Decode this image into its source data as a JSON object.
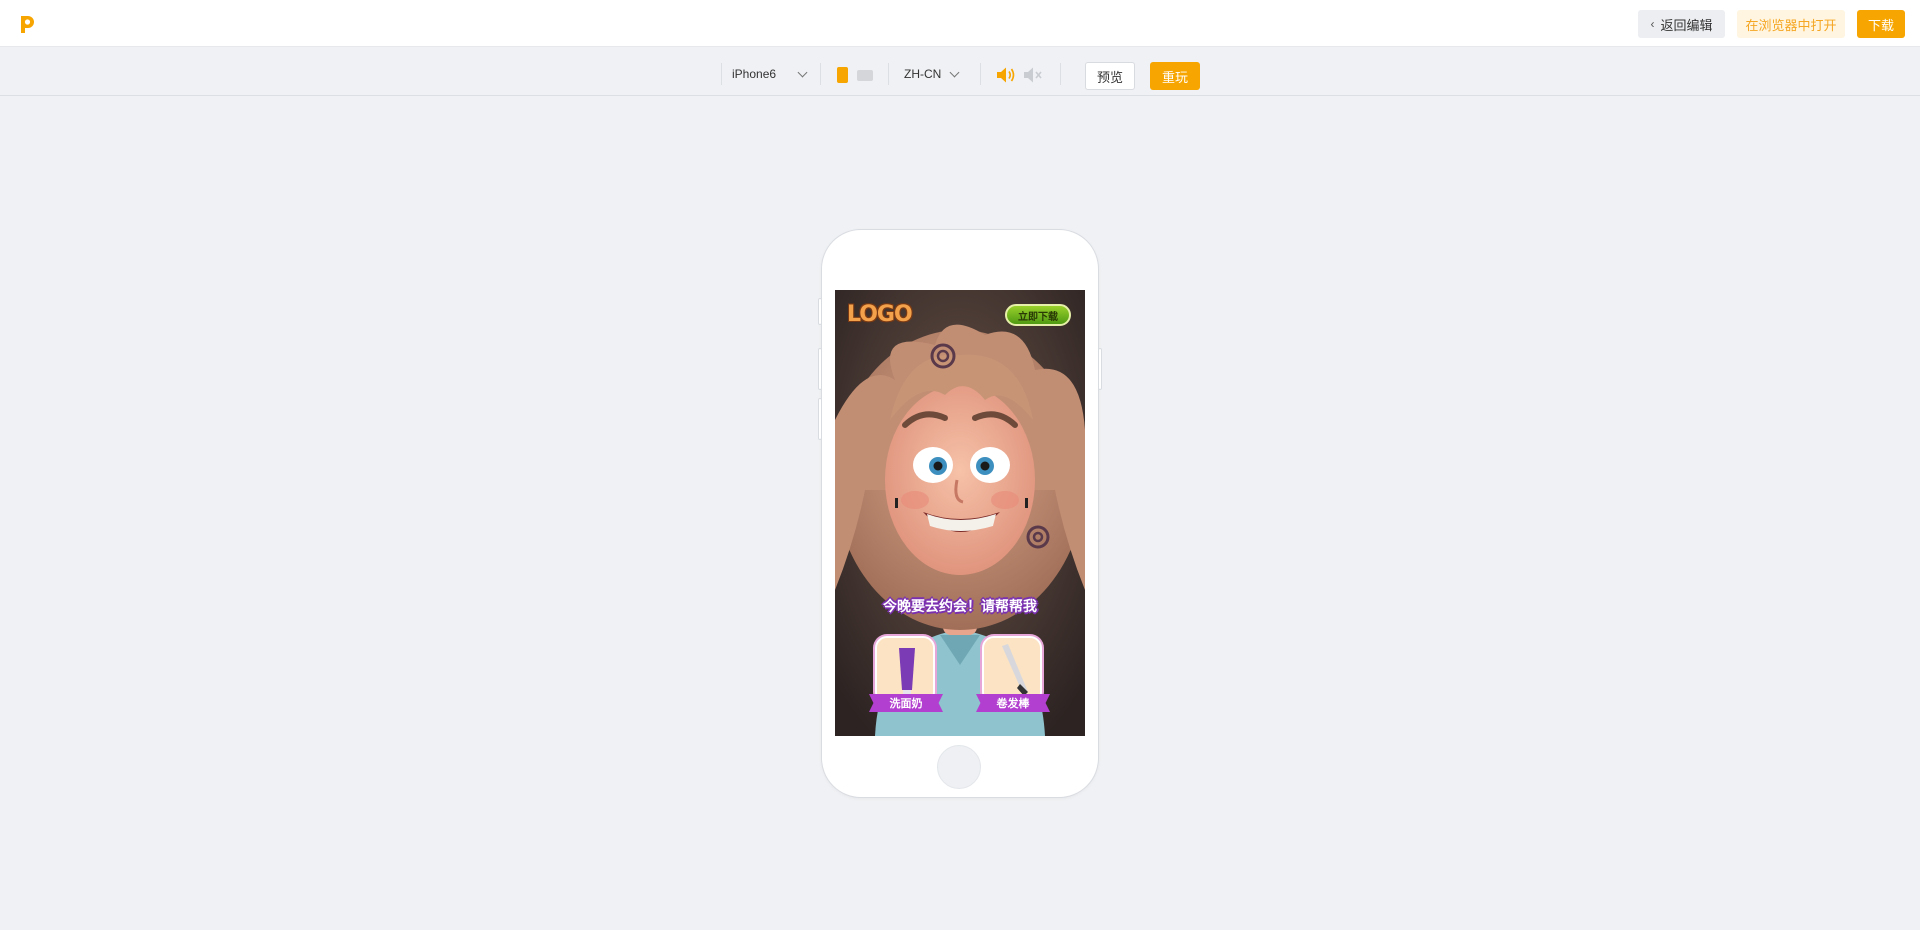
{
  "header": {
    "back_label": "返回编辑",
    "open_in_browser_label": "在浏览器中打开",
    "download_label": "下载"
  },
  "toolbar": {
    "device": "iPhone6",
    "language": "ZH-CN",
    "preview_label": "预览",
    "replay_label": "重玩"
  },
  "game": {
    "logo_text": "LOGO",
    "download_button": "立即下载",
    "prompt": "今晚要去约会！请帮帮我",
    "choices": [
      {
        "label": "洗面奶"
      },
      {
        "label": "卷发棒"
      }
    ]
  },
  "colors": {
    "accent": "#f7a500",
    "accent_light": "#fff5e0",
    "background": "#eff1f4",
    "choice_ribbon": "#b23fcf"
  },
  "icons": {
    "logo": "p-logo-icon",
    "back": "chevron-left-icon",
    "dropdown": "chevron-down-icon",
    "portrait": "portrait-orientation-icon",
    "landscape": "landscape-orientation-icon",
    "sound_on": "volume-on-icon",
    "sound_off": "volume-mute-icon"
  }
}
